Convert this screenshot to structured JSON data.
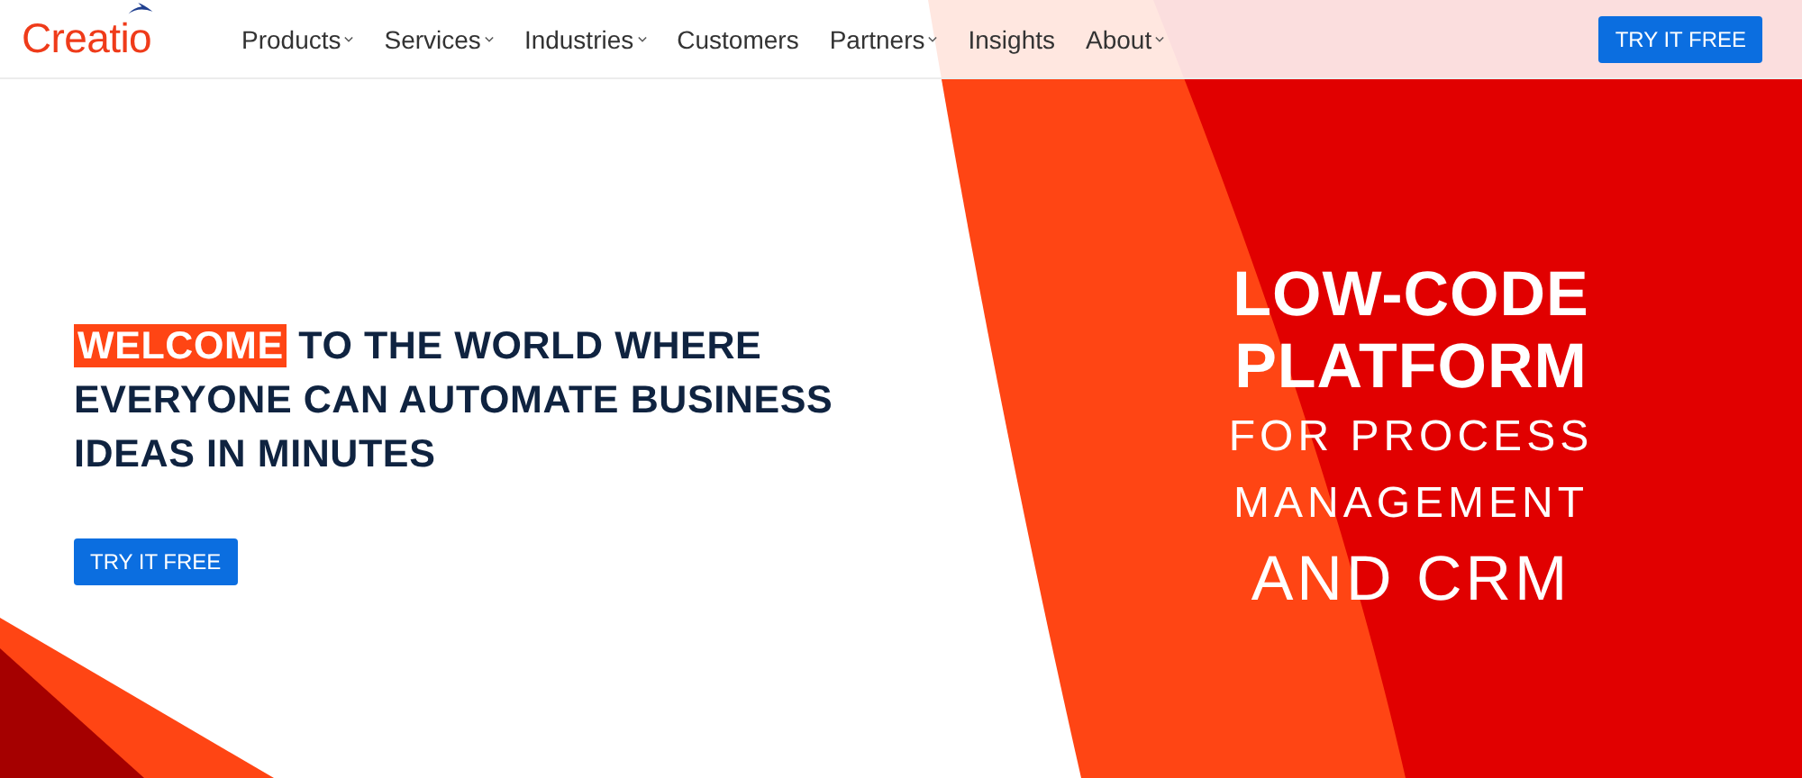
{
  "header": {
    "logo": "Creatio",
    "nav": [
      {
        "label": "Products",
        "dropdown": true
      },
      {
        "label": "Services",
        "dropdown": true
      },
      {
        "label": "Industries",
        "dropdown": true
      },
      {
        "label": "Customers",
        "dropdown": false
      },
      {
        "label": "Partners",
        "dropdown": true
      },
      {
        "label": "Insights",
        "dropdown": false
      },
      {
        "label": "About",
        "dropdown": true
      }
    ],
    "cta": "TRY IT FREE"
  },
  "hero": {
    "highlight": "WELCOME",
    "headline": "TO THE WORLD WHERE EVERYONE CAN AUTOMATE BUSINESS IDEAS IN MINUTES",
    "cta": "TRY IT FREE"
  },
  "promo": {
    "lines": [
      {
        "text": "LOW-CODE",
        "kind": "bold"
      },
      {
        "text": "PLATFORM",
        "kind": "bold"
      },
      {
        "text": "FOR PROCESS",
        "kind": "light"
      },
      {
        "text": "MANAGEMENT",
        "kind": "light"
      },
      {
        "text": "AND CRM",
        "kind": "large"
      }
    ]
  }
}
